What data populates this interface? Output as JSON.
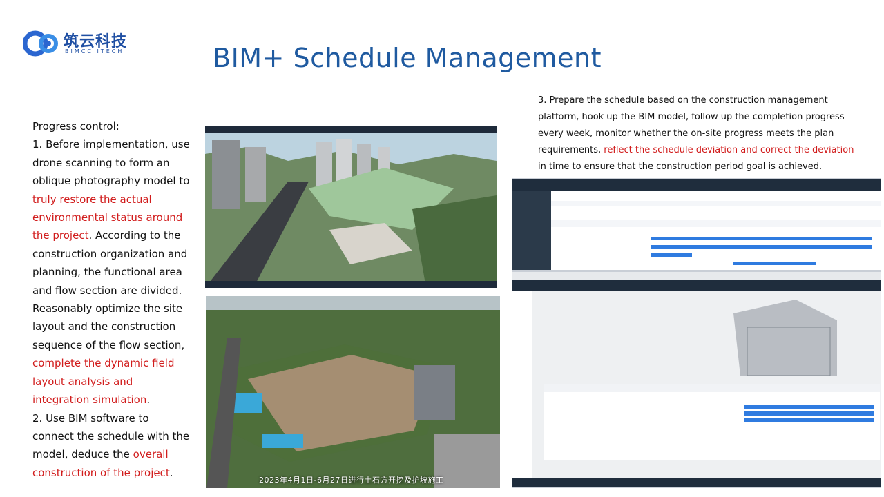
{
  "logo": {
    "name_cn": "筑云科技",
    "name_en": "BIMCC ITECH"
  },
  "title": "BIM+ Schedule Management",
  "left_text": {
    "p1": "Progress control:",
    "p2": "1. Before implementation, use drone scanning to form an oblique photography model to ",
    "p2_red": "truly restore the actual environmental status around the project",
    "p3": ". According to the construction organization and planning, the functional area and flow section are divided. Reasonably optimize the site layout and the construction sequence of the flow section, ",
    "p3_red": "complete the dynamic field layout analysis and integration simulation",
    "p4": ".",
    "p5": "2. Use BIM software to connect the schedule with the model, deduce the ",
    "p5_red": "overall construction of the project",
    "p6": "."
  },
  "right_text": {
    "t1": "3. Prepare the schedule based on the construction management platform, hook up the BIM model, follow up the completion progress every week, monitor whether the on-site progress meets the plan requirements, ",
    "t1_red": "reflect the schedule deviation and correct the deviation",
    "t2": " in time to ensure that the construction period goal is achieved."
  },
  "images": {
    "aerial_caption": "2023年4月1日-6月27日进行土石方开挖及护坡施工"
  },
  "colors": {
    "title": "#1f5aa0",
    "highlight": "#d11c1c",
    "brand": "#1f4fa3"
  }
}
